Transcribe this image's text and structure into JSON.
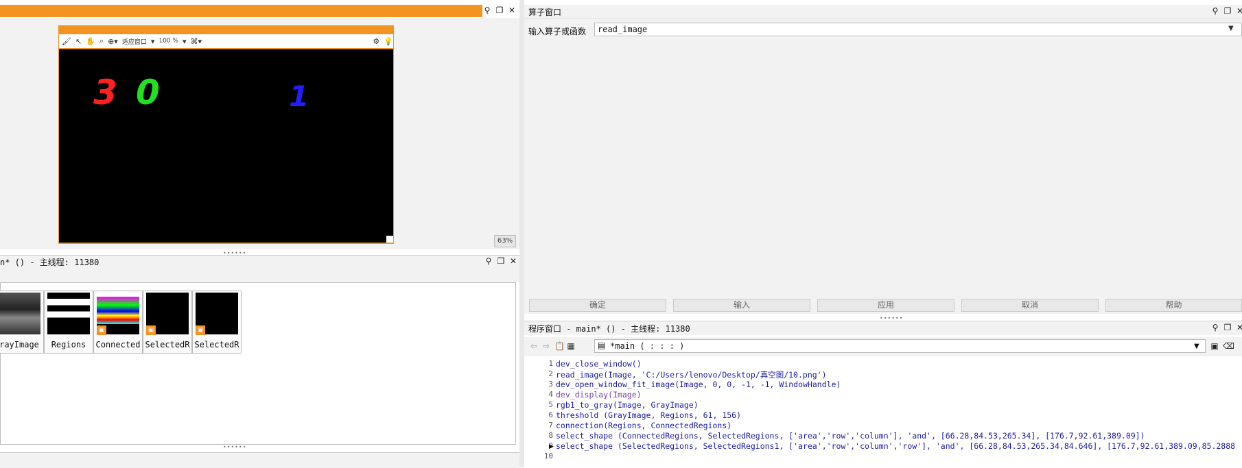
{
  "graphics": {
    "zoom": "63%",
    "toolbar": {
      "fit_label": "适应窗口",
      "zoom_label": "100 %"
    },
    "digits": [
      {
        "text": "3",
        "color": "#ff2020"
      },
      {
        "text": "0",
        "color": "#20e020"
      },
      {
        "text": "1",
        "color": "#2020ff"
      }
    ]
  },
  "variables": {
    "title": "n* () - 主线程: 11380",
    "items": [
      {
        "label": "rayImage"
      },
      {
        "label": "Regions"
      },
      {
        "label": "Connected"
      },
      {
        "label": "SelectedR"
      },
      {
        "label": "SelectedR"
      }
    ]
  },
  "operator": {
    "title": "算子窗口",
    "label": "输入算子或函数",
    "input_value": "read_image",
    "buttons": [
      "确定",
      "输入",
      "应用",
      "取消",
      "帮助"
    ]
  },
  "program": {
    "title": "程序窗口 - main* () - 主线程: 11380",
    "procedure": "*main ( : : : )",
    "lines": [
      {
        "n": "1",
        "code": "dev_close_window()"
      },
      {
        "n": "2",
        "code": "read_image(Image, 'C:/Users/lenovo/Desktop/真空图/10.png')"
      },
      {
        "n": "3",
        "code": "dev_open_window_fit_image(Image, 0, 0, -1, -1, WindowHandle)"
      },
      {
        "n": "4",
        "code": "dev_display(Image)"
      },
      {
        "n": "5",
        "code": "rgb1_to_gray(Image, GrayImage)"
      },
      {
        "n": "6",
        "code": "threshold (GrayImage, Regions, 61, 156)"
      },
      {
        "n": "7",
        "code": "connection(Regions, ConnectedRegions)"
      },
      {
        "n": "8",
        "code": "select_shape (ConnectedRegions, SelectedRegions, ['area','row','column'], 'and', [66.28,84.53,265.34], [176.7,92.61,389.09])"
      },
      {
        "n": "9",
        "code": "select_shape (SelectedRegions, SelectedRegions1, ['area','row','column','row'], 'and', [66.28,84.53,265.34,84.646], [176.7,92.61,389.09,85.2888"
      },
      {
        "n": "10",
        "code": ""
      }
    ]
  }
}
